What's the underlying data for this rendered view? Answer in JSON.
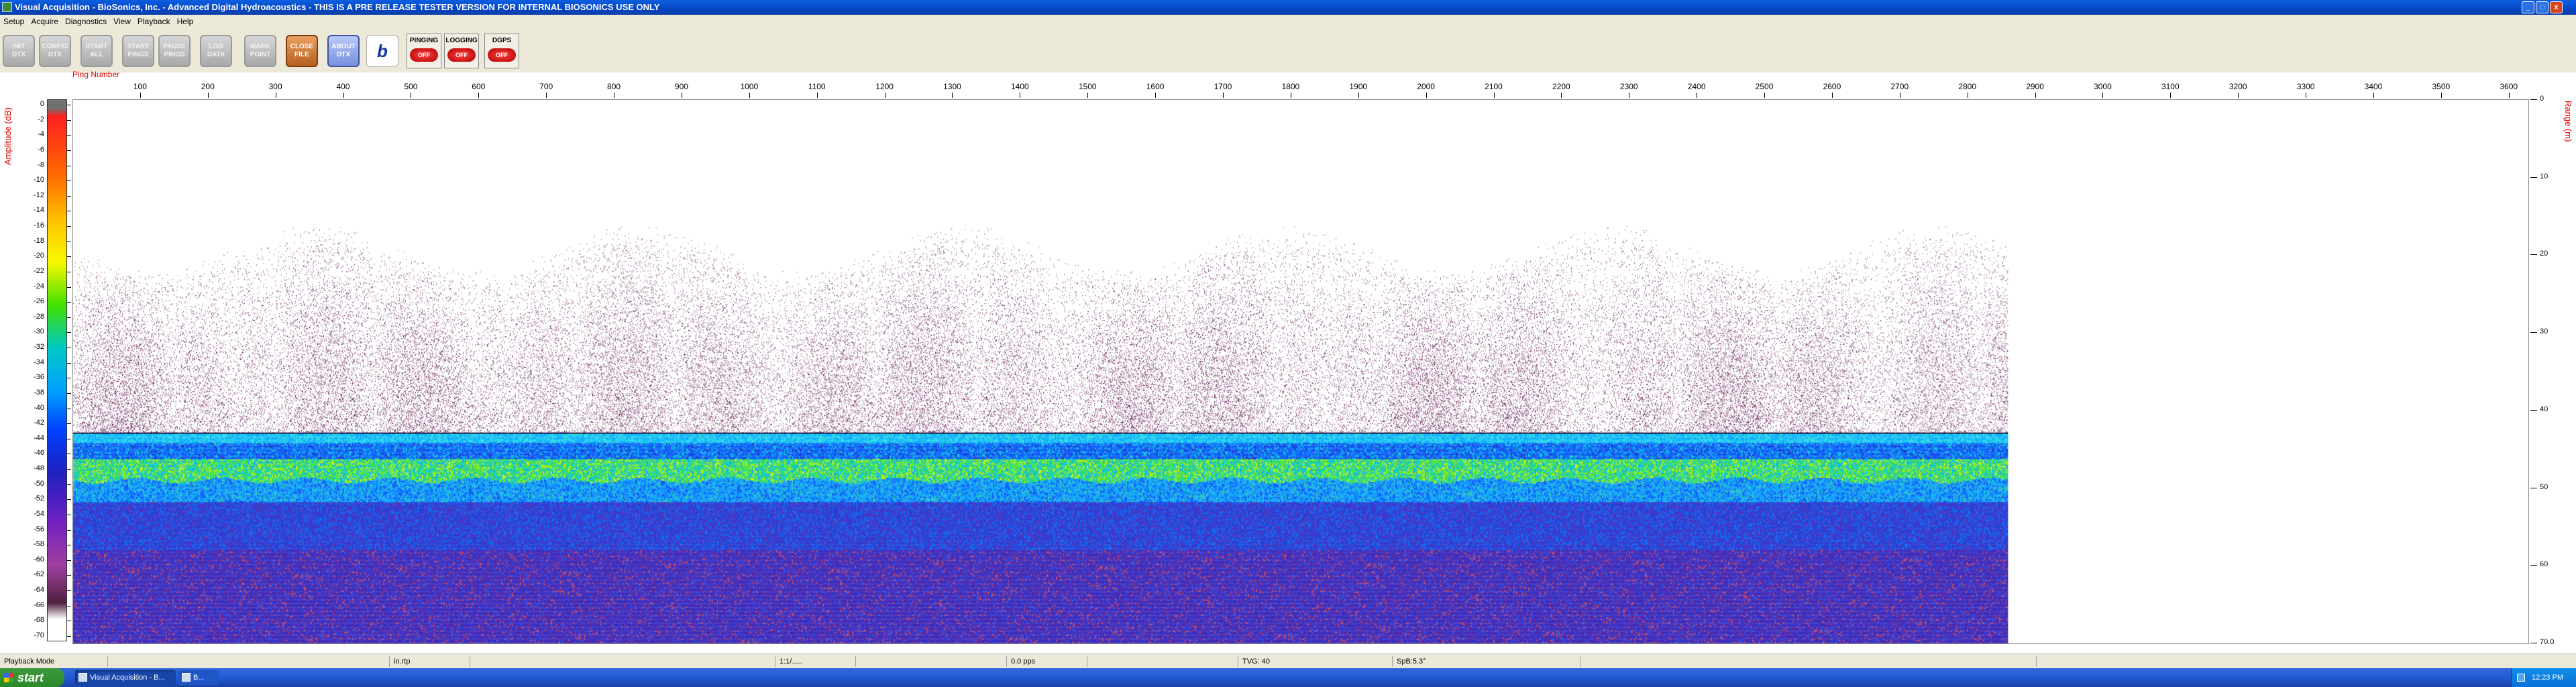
{
  "window": {
    "title": "Visual Acquisition  -  BioSonics, Inc.  -  Advanced Digital Hydroacoustics  -  THIS IS A PRE RELEASE TESTER VERSION FOR INTERNAL BIOSONICS USE ONLY",
    "minimize_label": "_",
    "maximize_label": "□",
    "close_label": "x"
  },
  "menu": [
    "Setup",
    "Acquire",
    "Diagnostics",
    "View",
    "Playback",
    "Help"
  ],
  "toolbar": {
    "buttons": [
      {
        "label": "INIT\nDTX"
      },
      {
        "label": "CONFIG\nDTX"
      },
      {
        "label": "START\nALL"
      },
      {
        "label": "START\nPINGS"
      },
      {
        "label": "PAUSE\nPINGS"
      },
      {
        "label": "LOG\nDATA"
      },
      {
        "label": "MARK\nPOINT"
      },
      {
        "label": "CLOSE\nFILE"
      },
      {
        "label": "ABOUT\nDTX"
      }
    ],
    "logo_glyph": "b",
    "status": [
      {
        "label": "PINGING",
        "state": "OFF"
      },
      {
        "label": "LOGGING",
        "state": "OFF"
      },
      {
        "label": "DGPS",
        "state": "OFF"
      }
    ]
  },
  "chart_data": {
    "type": "heatmap",
    "x_axis_label": "Ping Number",
    "x_ticks": [
      100,
      200,
      300,
      400,
      500,
      600,
      700,
      800,
      900,
      1000,
      1100,
      1200,
      1300,
      1400,
      1500,
      1600,
      1700,
      1800,
      1900,
      2000,
      2100,
      2200,
      2300,
      2400,
      2500,
      2600,
      2700,
      2800,
      2900,
      3000,
      3100,
      3200,
      3300,
      3400,
      3500,
      3600
    ],
    "xlim": [
      0,
      3630
    ],
    "data_ping_extent": [
      0,
      2860
    ],
    "y_axis_label": "Range (m)",
    "y_ticks": [
      0,
      10,
      20,
      30,
      40,
      50,
      60,
      70
    ],
    "y_tick_labels": [
      "0",
      "10",
      "20",
      "30",
      "40",
      "50",
      "60",
      "70.0"
    ],
    "ylim": [
      0,
      70
    ],
    "colorbar_label": "Amplitude (dB)",
    "colorbar_ticks": [
      0,
      -2,
      -4,
      -6,
      -8,
      -10,
      -12,
      -14,
      -16,
      -18,
      -20,
      -22,
      -24,
      -26,
      -28,
      -30,
      -32,
      -34,
      -36,
      -38,
      -40,
      -42,
      -44,
      -46,
      -48,
      -50,
      -52,
      -54,
      -56,
      -58,
      -60,
      -62,
      -64,
      -66,
      -68,
      -70
    ],
    "colorbar_range": [
      -70,
      0
    ],
    "bottom_depth_m": 43,
    "colors": {
      "weak_echo": "#6a1a5a",
      "bottom_band": "#00c8e8",
      "strong_band": "#40e040",
      "deep_noise": "#2828c0"
    }
  },
  "statusbar": {
    "panels": [
      {
        "text": "Playback Mode"
      },
      {
        "text": ""
      },
      {
        "text": "in.rtp"
      },
      {
        "text": ""
      },
      {
        "text": "1:1/....."
      },
      {
        "text": ""
      },
      {
        "text": "0.0 pps"
      },
      {
        "text": ""
      },
      {
        "text": "TVG: 40"
      },
      {
        "text": "SpB:5.3°"
      },
      {
        "text": ""
      },
      {
        "text": ""
      }
    ]
  },
  "taskbar": {
    "start_label": "start",
    "tasks": [
      {
        "label": "Visual Acquisition - B..."
      },
      {
        "label": "B..."
      }
    ],
    "clock": "12:23 PM"
  }
}
